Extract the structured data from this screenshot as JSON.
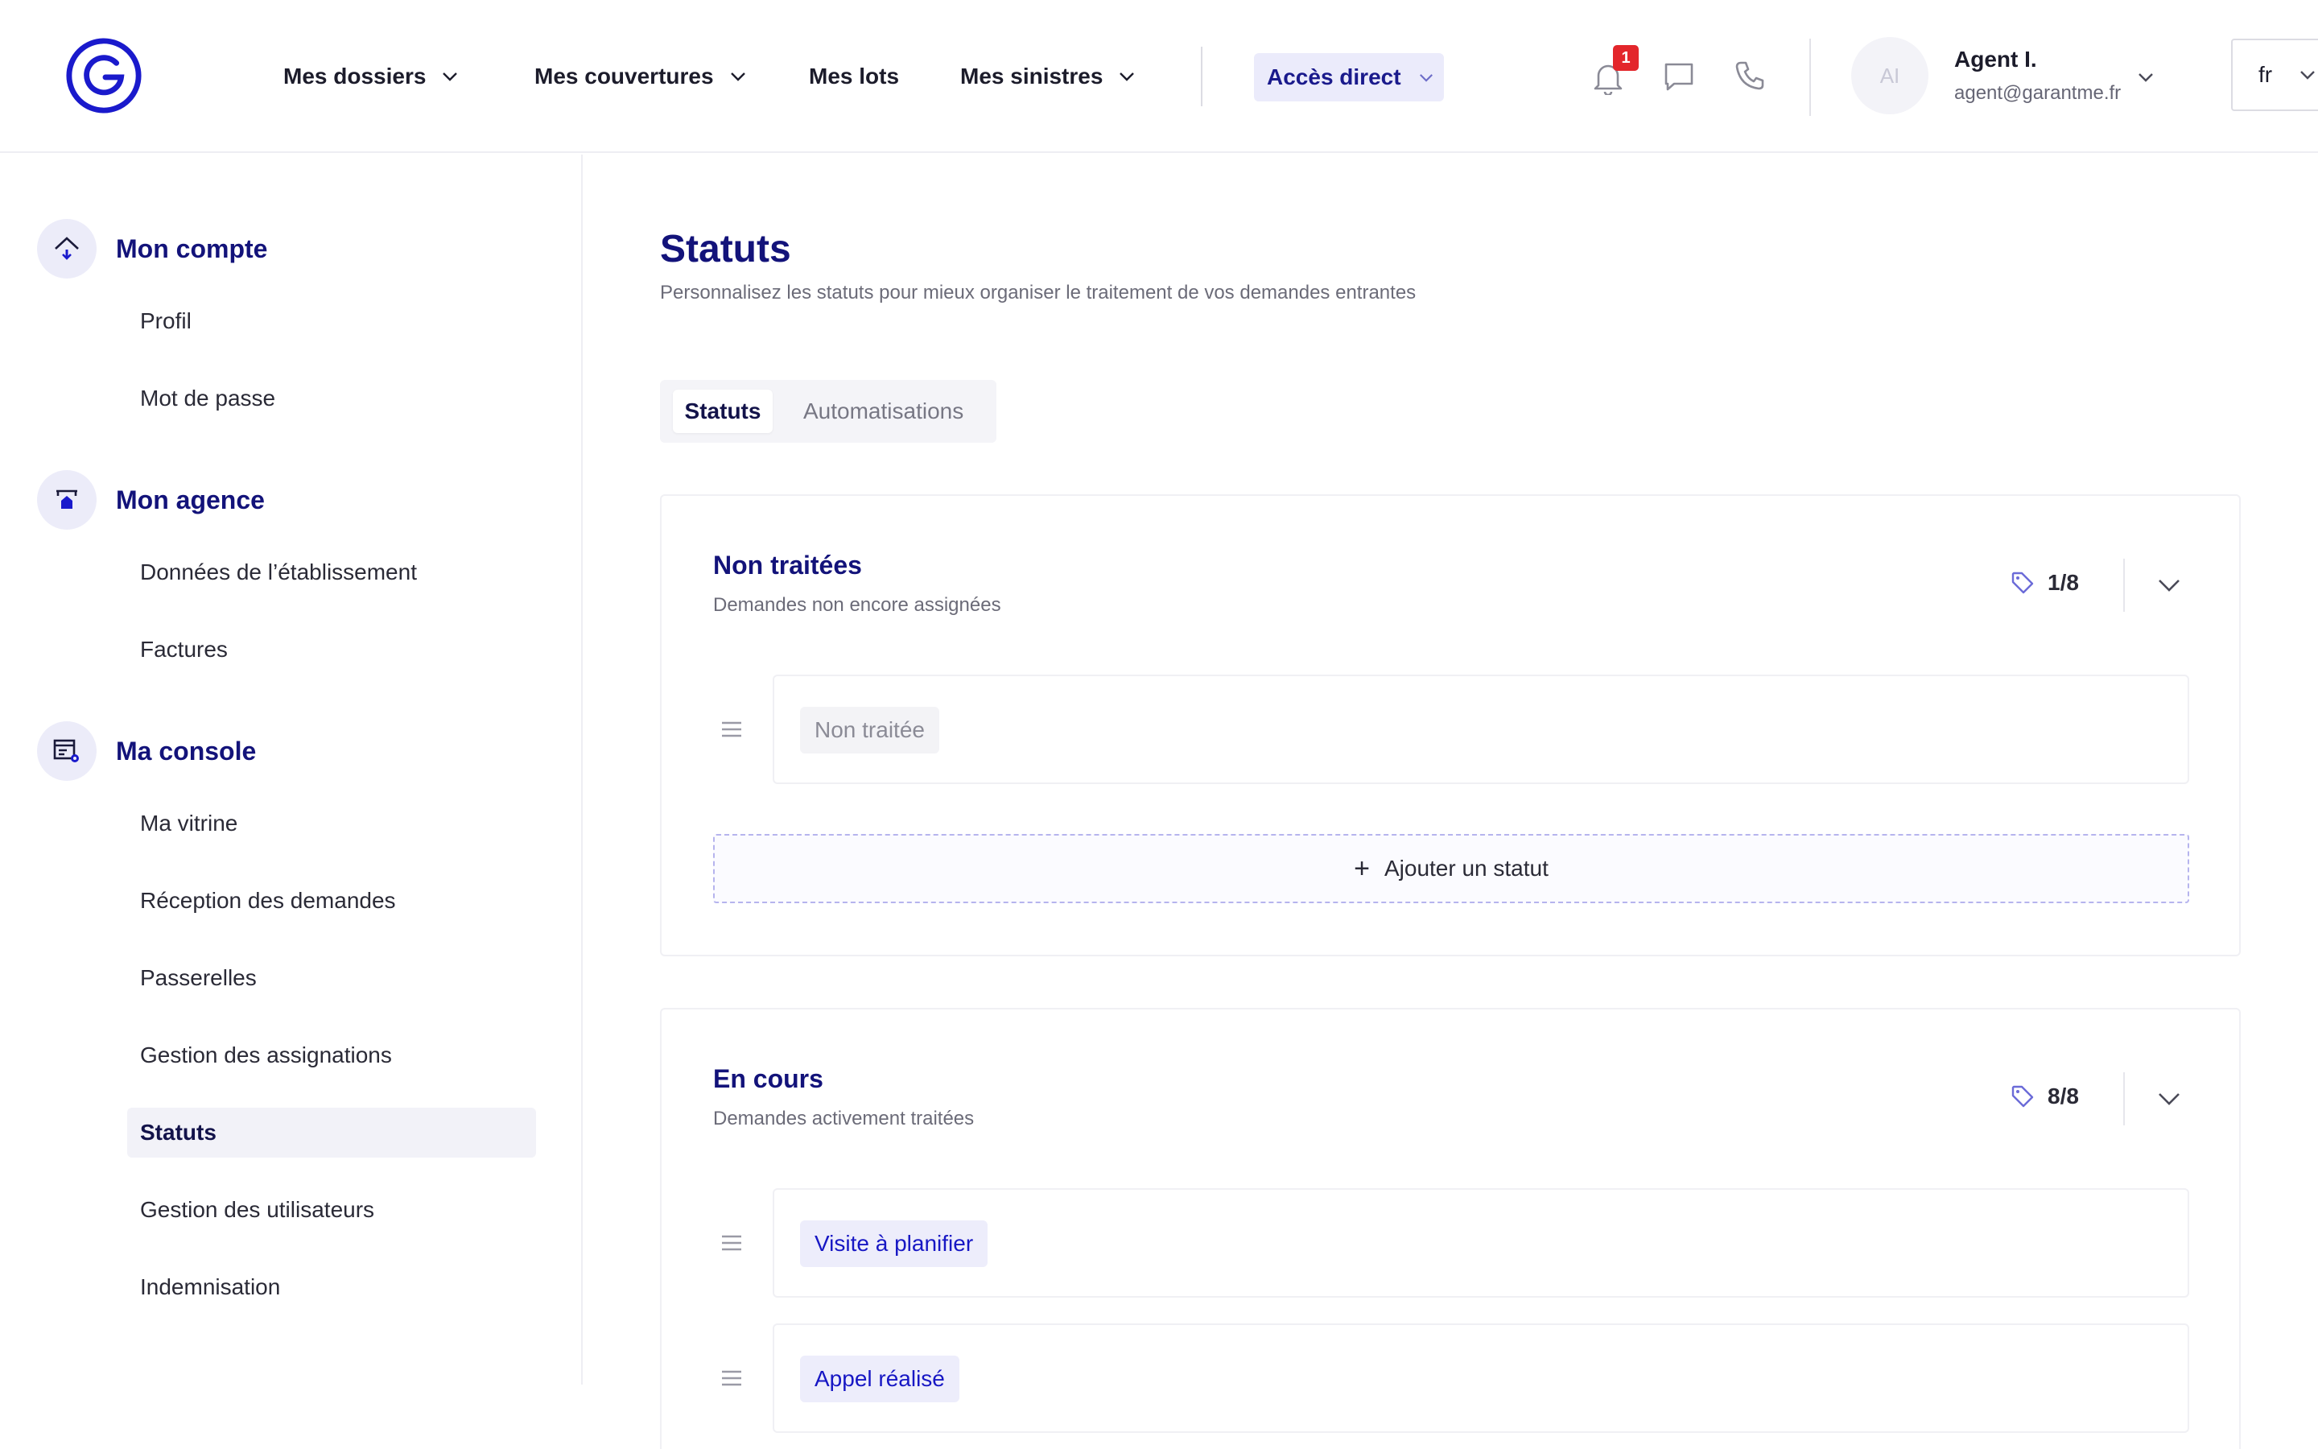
{
  "header": {
    "nav": [
      {
        "label": "Mes dossiers",
        "has_dropdown": true
      },
      {
        "label": "Mes couvertures",
        "has_dropdown": true
      },
      {
        "label": "Mes lots",
        "has_dropdown": false
      },
      {
        "label": "Mes sinistres",
        "has_dropdown": true
      }
    ],
    "acces_direct": "Accès direct",
    "notification_count": "1",
    "icons": [
      "bell-icon",
      "chat-icon",
      "phone-icon"
    ],
    "user": {
      "initials": "AI",
      "name": "Agent I.",
      "email": "agent@garantme.fr"
    },
    "language": "fr"
  },
  "sidebar": {
    "sections": [
      {
        "title": "Mon compte",
        "icon": "home-icon",
        "items": [
          "Profil",
          "Mot de passe"
        ]
      },
      {
        "title": "Mon agence",
        "icon": "storefront-icon",
        "items": [
          "Données de l’établissement",
          "Factures"
        ]
      },
      {
        "title": "Ma console",
        "icon": "console-settings-icon",
        "items": [
          "Ma vitrine",
          "Réception des demandes",
          "Passerelles",
          "Gestion des assignations",
          "Statuts",
          "Gestion des utilisateurs",
          "Indemnisation"
        ]
      }
    ],
    "active_item": "Statuts"
  },
  "main": {
    "title": "Statuts",
    "subtitle": "Personnalisez les statuts pour mieux organiser le traitement de vos demandes entrantes",
    "tabs": [
      {
        "label": "Statuts",
        "active": true
      },
      {
        "label": "Automatisations",
        "active": false
      }
    ],
    "groups": [
      {
        "title": "Non traitées",
        "subtitle": "Demandes non encore assignées",
        "count": "1/8",
        "statuses": [
          "Non traitée"
        ],
        "add_label": "Ajouter un statut"
      },
      {
        "title": "En cours",
        "subtitle": "Demandes activement traitées",
        "count": "8/8",
        "statuses": [
          "Visite à planifier",
          "Appel réalisé"
        ]
      }
    ]
  },
  "colors": {
    "brand": "#1a1acc",
    "heading": "#13137a",
    "badge": "#e3262b",
    "chip_blue_bg": "#ededfb"
  }
}
